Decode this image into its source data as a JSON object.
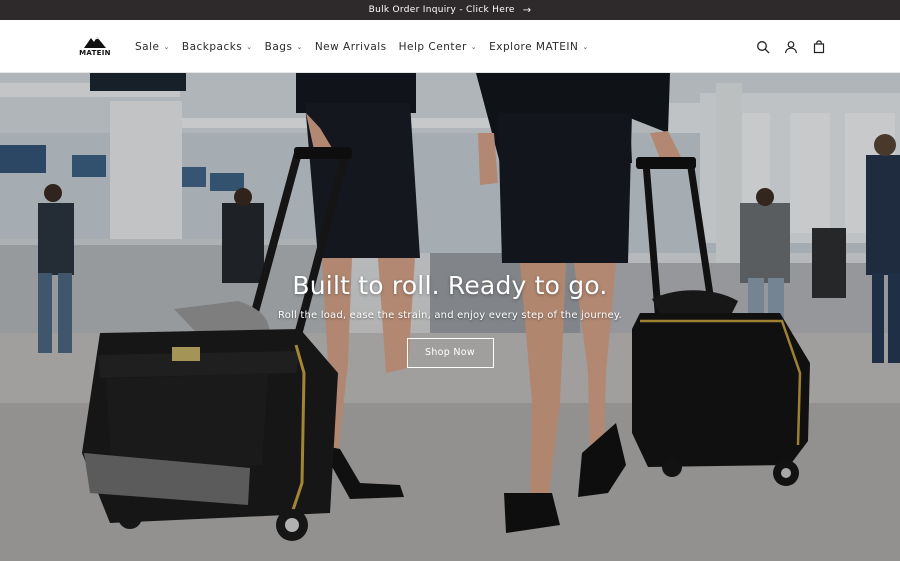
{
  "announcement": {
    "text": "Bulk Order Inquiry - Click Here",
    "arrow_icon": "arrow-right-icon"
  },
  "header": {
    "logo_text": "MATEIN",
    "nav": [
      {
        "label": "Sale",
        "has_dropdown": true
      },
      {
        "label": "Backpacks",
        "has_dropdown": true
      },
      {
        "label": "Bags",
        "has_dropdown": true
      },
      {
        "label": "New Arrivals",
        "has_dropdown": false
      },
      {
        "label": "Help Center",
        "has_dropdown": true
      },
      {
        "label": "Explore MATEIN",
        "has_dropdown": true
      }
    ],
    "icons": [
      "search-icon",
      "account-icon",
      "cart-icon"
    ]
  },
  "hero": {
    "title": "Built to roll. Ready to go.",
    "subtitle": "Roll the load, ease the strain, and enjoy every step of the journey.",
    "cta_label": "Shop Now"
  },
  "colors": {
    "announcement_bg": "#2e2a2b",
    "text": "#1f1f1f",
    "hero_text": "#ffffff"
  }
}
